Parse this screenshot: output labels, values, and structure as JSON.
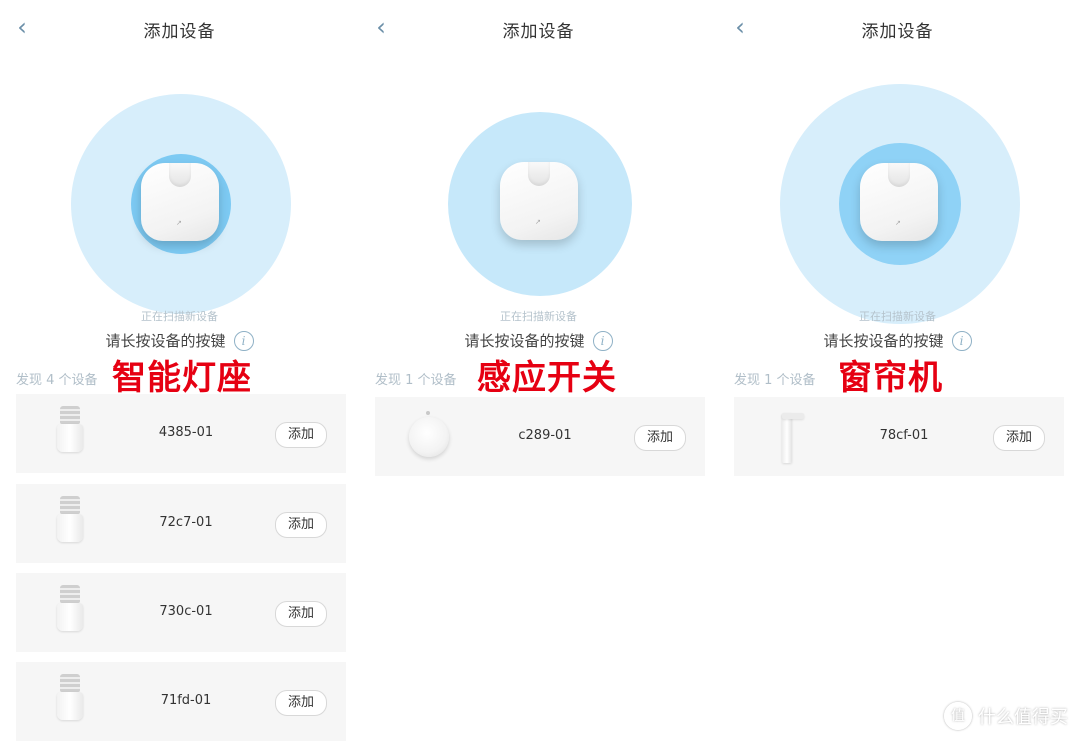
{
  "panels": [
    {
      "title": "添加设备",
      "scanning_text": "正在扫描新设备",
      "hint": "请长按设备的按键",
      "found_text": "发现 4 个设备",
      "category_overlay": "智能灯座",
      "add_label": "添加",
      "devices": [
        {
          "name": "4385-01",
          "icon": "bulb-socket-icon"
        },
        {
          "name": "72c7-01",
          "icon": "bulb-socket-icon"
        },
        {
          "name": "730c-01",
          "icon": "bulb-socket-icon"
        },
        {
          "name": "71fd-01",
          "icon": "bulb-socket-icon"
        }
      ]
    },
    {
      "title": "添加设备",
      "scanning_text": "正在扫描新设备",
      "hint": "请长按设备的按键",
      "found_text": "发现 1 个设备",
      "category_overlay": "感应开关",
      "add_label": "添加",
      "devices": [
        {
          "name": "c289-01",
          "icon": "motion-switch-icon"
        }
      ]
    },
    {
      "title": "添加设备",
      "scanning_text": "正在扫描新设备",
      "hint": "请长按设备的按键",
      "found_text": "发现 1 个设备",
      "category_overlay": "窗帘机",
      "add_label": "添加",
      "devices": [
        {
          "name": "78cf-01",
          "icon": "curtain-motor-icon"
        }
      ]
    }
  ],
  "icons": {
    "back": "chevron-left-icon",
    "info": "info-icon",
    "hub": "gateway-hub-icon"
  },
  "colors": {
    "scan_outer": "#d7eefb",
    "scan_inner": "#7dcaf3",
    "overlay_text": "#e60012",
    "card_bg": "#f6f6f6",
    "accent": "#8fb1c6"
  },
  "watermark": "什么值得买"
}
